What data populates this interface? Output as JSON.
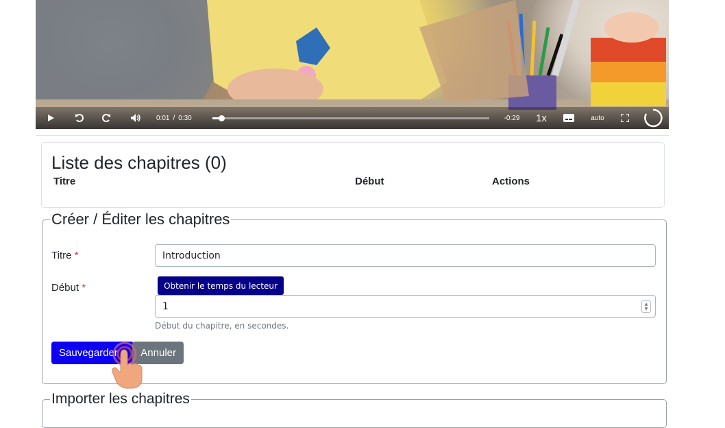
{
  "player": {
    "current_time": "0:01",
    "separator": "/",
    "duration": "0:30",
    "remaining": "-0:29",
    "speed": "1x",
    "quality": "auto",
    "progress": 0.033,
    "icons": [
      "play-icon",
      "rewind-icon",
      "forward-icon",
      "volume-icon",
      "subtitles-icon",
      "fullscreen-icon",
      "logo-icon"
    ]
  },
  "chapter_list": {
    "title": "Liste des chapitres (0)",
    "columns": [
      "Titre",
      "Début",
      "Actions"
    ]
  },
  "edit_form": {
    "legend": "Créer / Éditer les chapitres",
    "title_label": "Titre",
    "required_mark": "*",
    "title_value": "Introduction",
    "start_label": "Début",
    "get_time_button": "Obtenir le temps du lecteur",
    "start_value": "1",
    "start_help": "Début du chapitre, en secondes.",
    "save_button": "Sauvegarder",
    "cancel_button": "Annuler"
  },
  "import_form": {
    "legend": "Importer les chapitres"
  },
  "colors": {
    "primary": "#0d00f0",
    "dark_blue": "#05008a",
    "secondary": "#6c757d",
    "required": "#dc3545"
  }
}
